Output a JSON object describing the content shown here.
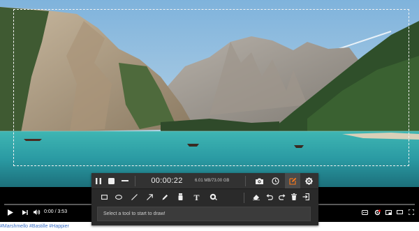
{
  "video": {
    "current_time": "0:00",
    "duration": "3:53",
    "progress_fraction": 0.0
  },
  "description": {
    "hashtags": "#Marshmello #Bastille #Happier"
  },
  "recorder": {
    "timer": "00:00:22",
    "file_size": "6.01 MB/73.00 GB",
    "hint": "Select a tool to start to draw!",
    "accent_color": "#ff7a1a"
  },
  "icons": {
    "pause": "pause-icon",
    "stop": "stop-icon",
    "minimize": "minimize-icon",
    "camera": "camera-icon",
    "clock": "clock-icon",
    "edit": "edit-icon",
    "gear": "gear-icon",
    "rectangle": "rectangle-icon",
    "ellipse": "ellipse-icon",
    "line": "line-icon",
    "arrow": "arrow-icon",
    "pen": "pen-icon",
    "highlighter": "highlighter-icon",
    "text": "text-icon",
    "color": "color-picker-icon",
    "eraser": "eraser-icon",
    "undo": "undo-icon",
    "redo": "redo-icon",
    "trash": "trash-icon",
    "exit": "exit-icon"
  }
}
